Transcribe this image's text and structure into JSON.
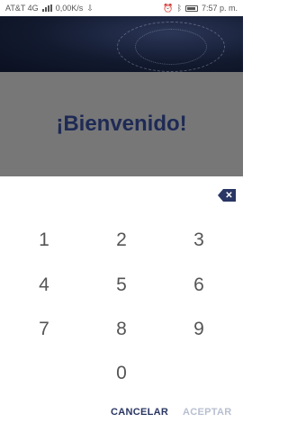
{
  "status_bar": {
    "carrier": "AT&T 4G",
    "data_speed": "0,00K/s",
    "time": "7:57 p. m."
  },
  "welcome": {
    "title": "¡Bienvenido!"
  },
  "keypad": {
    "keys": [
      "1",
      "2",
      "3",
      "4",
      "5",
      "6",
      "7",
      "8",
      "9",
      "0"
    ],
    "backspace_label": "✕",
    "cancel_label": "CANCELAR",
    "accept_label": "ACEPTAR"
  },
  "colors": {
    "accent": "#2a3663",
    "title": "#1e2a55",
    "overlay": "#777777"
  }
}
